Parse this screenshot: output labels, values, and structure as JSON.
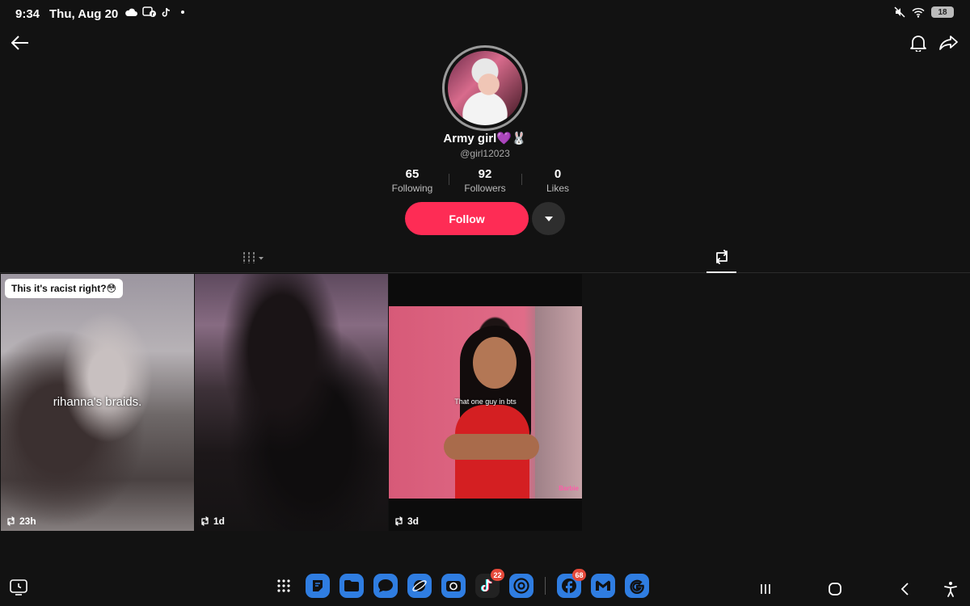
{
  "status_bar": {
    "time": "9:34",
    "date": "Thu, Aug 20",
    "battery": "18"
  },
  "profile": {
    "display_name": "Army girl💜🐰",
    "username": "@girl12023",
    "stats": [
      {
        "value": "65",
        "label": "Following"
      },
      {
        "value": "92",
        "label": "Followers"
      },
      {
        "value": "0",
        "label": "Likes"
      }
    ],
    "follow_label": "Follow"
  },
  "tabs": {
    "active": "reposts"
  },
  "videos": [
    {
      "caption": "This it's racist right?😳",
      "overlay": "rihanna's braids.",
      "age": "23h"
    },
    {
      "caption": "",
      "overlay": "",
      "age": "1d"
    },
    {
      "caption": "",
      "overlay": "That one guy in bts",
      "age": "3d",
      "brand": "Barbie"
    }
  ],
  "dock": {
    "apps": [
      {
        "name": "app-drawer",
        "badge": null
      },
      {
        "name": "notes",
        "badge": null
      },
      {
        "name": "files",
        "badge": null
      },
      {
        "name": "messages",
        "badge": null
      },
      {
        "name": "browser",
        "badge": null
      },
      {
        "name": "camera",
        "badge": null
      },
      {
        "name": "tiktok",
        "badge": "22"
      },
      {
        "name": "chrome",
        "badge": null
      },
      {
        "name": "facebook",
        "badge": "68"
      },
      {
        "name": "gmail",
        "badge": null
      },
      {
        "name": "google",
        "badge": null
      }
    ]
  },
  "colors": {
    "background": "#121212",
    "follow_button": "#fe2c55",
    "badge": "#e5493a",
    "app_blue": "#2f7de1"
  }
}
